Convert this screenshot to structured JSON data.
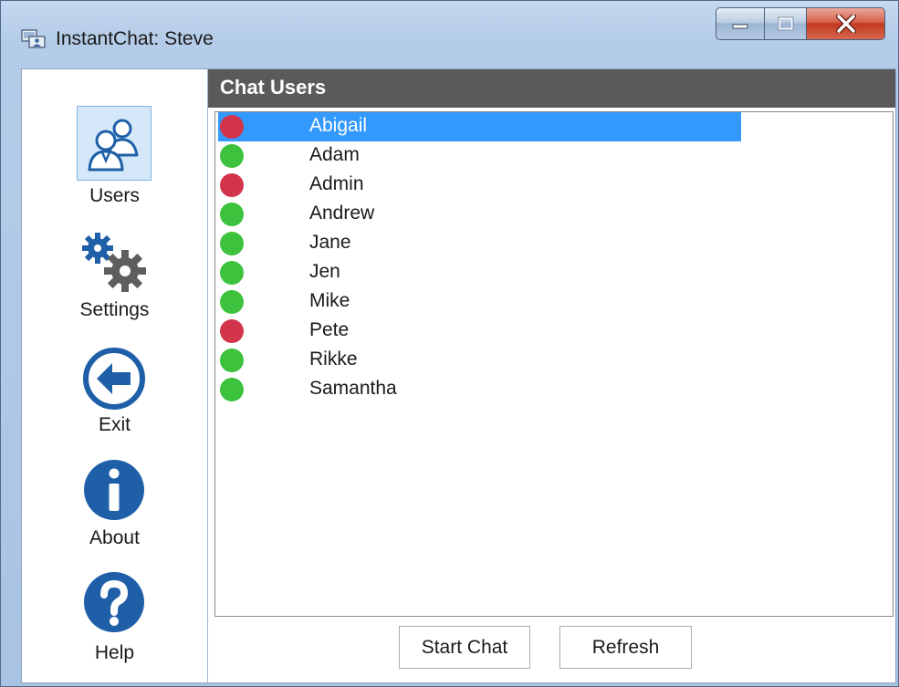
{
  "window": {
    "title": "InstantChat: Steve",
    "app_icon": "chat-app-icon",
    "controls": [
      "minimize-icon",
      "maximize-icon",
      "close-icon"
    ],
    "close_color": "#c2391f"
  },
  "sidebar": {
    "items": [
      {
        "label": "Users",
        "icon": "users-icon",
        "selected": true
      },
      {
        "label": "Settings",
        "icon": "gears-icon",
        "selected": false
      },
      {
        "label": "Exit",
        "icon": "back-arrow-icon",
        "selected": false
      },
      {
        "label": "About",
        "icon": "info-icon",
        "selected": false
      },
      {
        "label": "Help",
        "icon": "help-icon",
        "selected": false
      }
    ],
    "icon_color": "#1f5fa8"
  },
  "main": {
    "header": "Chat Users",
    "users": [
      {
        "name": "Abigail",
        "status": "offline",
        "selected": true
      },
      {
        "name": "Adam",
        "status": "online",
        "selected": false
      },
      {
        "name": "Admin",
        "status": "offline",
        "selected": false
      },
      {
        "name": "Andrew",
        "status": "online",
        "selected": false
      },
      {
        "name": "Jane",
        "status": "online",
        "selected": false
      },
      {
        "name": "Jen",
        "status": "online",
        "selected": false
      },
      {
        "name": "Mike",
        "status": "online",
        "selected": false
      },
      {
        "name": "Pete",
        "status": "offline",
        "selected": false
      },
      {
        "name": "Rikke",
        "status": "online",
        "selected": false
      },
      {
        "name": "Samantha",
        "status": "online",
        "selected": false
      }
    ],
    "status_colors": {
      "online": "#3cc23c",
      "offline": "#d2344c"
    },
    "buttons": {
      "start_chat": "Start Chat",
      "refresh": "Refresh"
    }
  }
}
